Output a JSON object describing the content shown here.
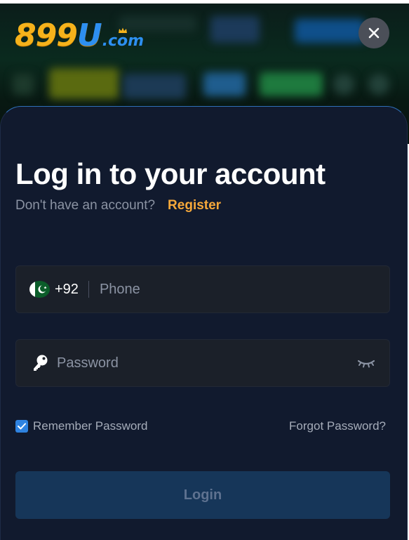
{
  "brand": {
    "logo_main": "899U",
    "logo_suffix": ".com"
  },
  "login": {
    "title": "Log in to your account",
    "no_account_text": "Don't have an account?",
    "register_label": "Register",
    "phone": {
      "country_code": "+92",
      "placeholder": "Phone"
    },
    "password": {
      "placeholder": "Password"
    },
    "remember_label": "Remember Password",
    "remember_checked": true,
    "forgot_label": "Forgot Password?",
    "login_label": "Login"
  },
  "colors": {
    "accent_register": "#f6a83a",
    "panel_bg": "#111a2e",
    "login_button_bg": "#163659",
    "checkbox": "#2f83e0"
  }
}
